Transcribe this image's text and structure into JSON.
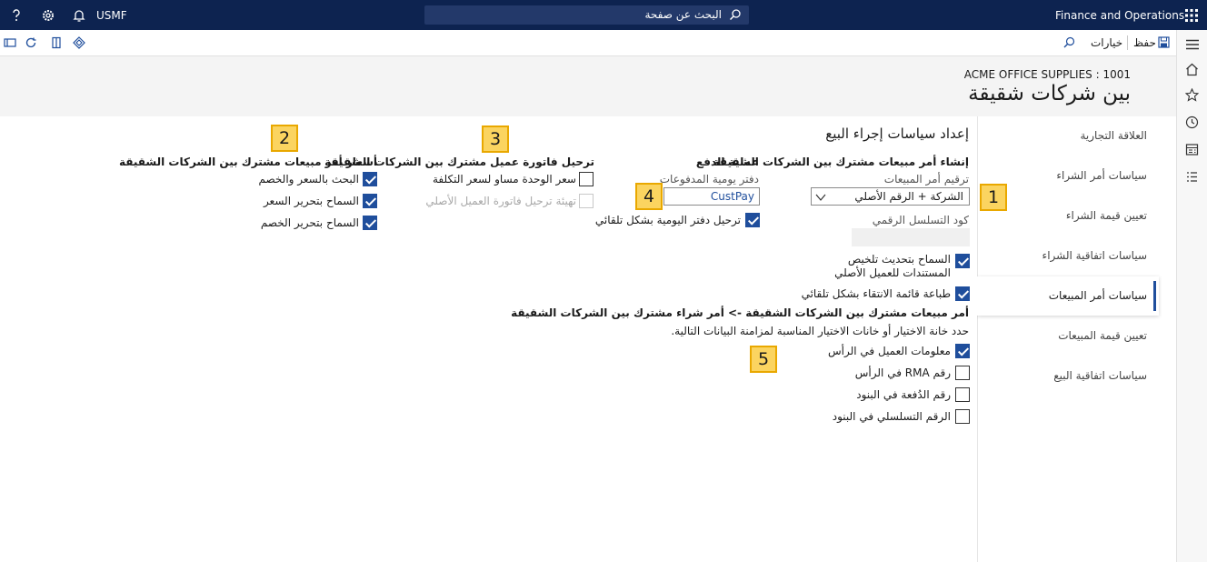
{
  "topbar": {
    "app_title": "Finance and Operations",
    "search_placeholder": "البحث عن صفحة",
    "company_code": "USMF"
  },
  "actionbar": {
    "save_label": "حفظ",
    "options_label": "خيارات"
  },
  "header": {
    "company_line": "ACME OFFICE SUPPLIES : 1001",
    "page_title": "بين شركات شقيقة"
  },
  "tabs": [
    {
      "label": "العلاقة التجارية"
    },
    {
      "label": "سياسات أمر الشراء"
    },
    {
      "label": "تعيين قيمة الشراء"
    },
    {
      "label": "سياسات اتفاقية الشراء"
    },
    {
      "label": "سياسات أمر المبيعات",
      "active": true
    },
    {
      "label": "تعيين قيمة المبيعات"
    },
    {
      "label": "سياسات اتفاقية البيع"
    }
  ],
  "section": {
    "title": "إعداد سياسات إجراء البيع",
    "create_so": {
      "heading": "إنشاء أمر مبيعات مشترك بين الشركات الشقيقة",
      "numbering_label": "ترقيم أمر المبيعات",
      "numbering_value": "الشركة + الرقم الأصلي",
      "sequence_label": "كود التسلسل الرقمي",
      "allow_update_label": "السماح بتحديث تلخيص المستندات للعميل الأصلي",
      "allow_update_checked": true,
      "print_picking_label": "طباعة قائمة الانتقاء بشكل تلقائي",
      "print_picking_checked": true
    },
    "payment": {
      "heading": "عملية الدفع",
      "journal_label": "دفتر يومية المدفوعات",
      "journal_value": "CustPay",
      "auto_post_label": "ترحيل دفتر اليومية بشكل تلقائي",
      "auto_post_checked": true
    },
    "invoice_posting": {
      "heading": "ترحيل فاتورة عميل مشترك بين الشركات الشقيقة",
      "unit_price_label": "سعر الوحدة مساو لسعر التكلفة",
      "unit_price_checked": false,
      "prep_invoice_label": "تهيئة ترحيل فاتورة العميل الأصلي",
      "prep_invoice_checked": false
    },
    "pricing": {
      "heading": "أسعار أمر مبيعات مشترك بين الشركات الشقيقة",
      "search_price_label": "البحث بالسعر والخصم",
      "search_price_checked": true,
      "allow_price_label": "السماح بتحرير السعر",
      "allow_price_checked": true,
      "allow_discount_label": "السماح بتحرير الخصم",
      "allow_discount_checked": true
    },
    "sync": {
      "heading": "أمر مبيعات مشترك بين الشركات الشقيقة -> أمر شراء مشترك بين الشركات الشقيقة",
      "instructions": "حدد خانة الاختيار أو خانات الاختيار المناسبة لمزامنة البيانات التالية.",
      "customer_info_label": "معلومات العميل في الرأس",
      "customer_info_checked": true,
      "rma_label": "رقم RMA في الرأس",
      "rma_checked": false,
      "batch_label": "رقم الدُفعة في البنود",
      "batch_checked": false,
      "serial_label": "الرقم التسلسلي في البنود",
      "serial_checked": false
    }
  },
  "callouts": [
    "1",
    "2",
    "3",
    "4",
    "5"
  ]
}
